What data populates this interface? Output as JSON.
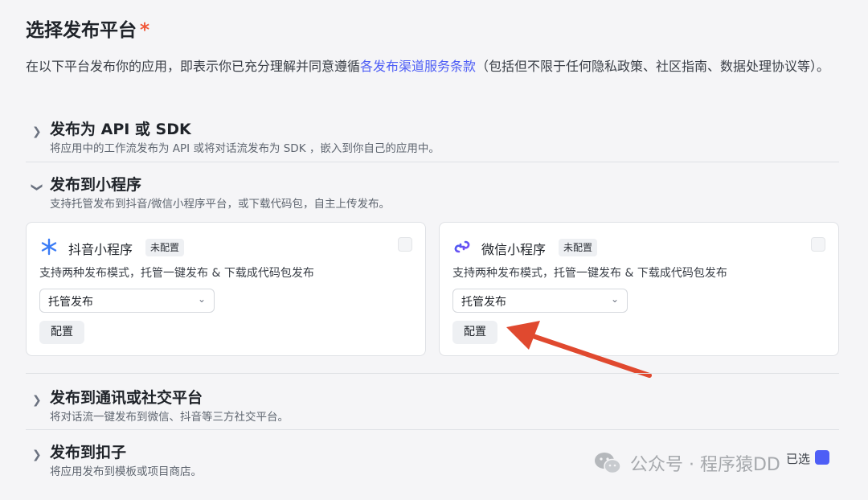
{
  "header": {
    "title": "选择发布平台",
    "required_mark": "*",
    "desc_prefix": "在以下平台发布你的应用，即表示你已充分理解并同意遵循",
    "desc_link": "各发布渠道服务条款",
    "desc_suffix": "（包括但不限于任何隐私政策、社区指南、数据处理协议等）。"
  },
  "sections": [
    {
      "title": "发布为 API 或 SDK",
      "subtitle": "将应用中的工作流发布为 API 或将对话流发布为 SDK ，嵌入到你自己的应用中。",
      "expanded": false
    },
    {
      "title": "发布到小程序",
      "subtitle": "支持托管发布到抖音/微信小程序平台，或下载代码包，自主上传发布。",
      "expanded": true
    },
    {
      "title": "发布到通讯或社交平台",
      "subtitle": "将对话流一键发布到微信、抖音等三方社交平台。",
      "expanded": false
    },
    {
      "title": "发布到扣子",
      "subtitle": "将应用发布到模板或项目商店。",
      "expanded": false
    }
  ],
  "cards": [
    {
      "name": "抖音小程序",
      "badge": "未配置",
      "desc": "支持两种发布模式，托管一键发布 & 下载成代码包发布",
      "select_value": "托管发布",
      "button": "配置",
      "icon": "douyin-miniapp-icon"
    },
    {
      "name": "微信小程序",
      "badge": "未配置",
      "desc": "支持两种发布模式，托管一键发布 & 下载成代码包发布",
      "select_value": "托管发布",
      "button": "配置",
      "icon": "wechat-miniapp-icon"
    }
  ],
  "footer": {
    "watermark": "公众号 · 程序猿DD",
    "selected_label": "已选"
  },
  "colors": {
    "accent": "#4e5ef6",
    "required": "#f0583a",
    "arrow": "#e0492f"
  }
}
